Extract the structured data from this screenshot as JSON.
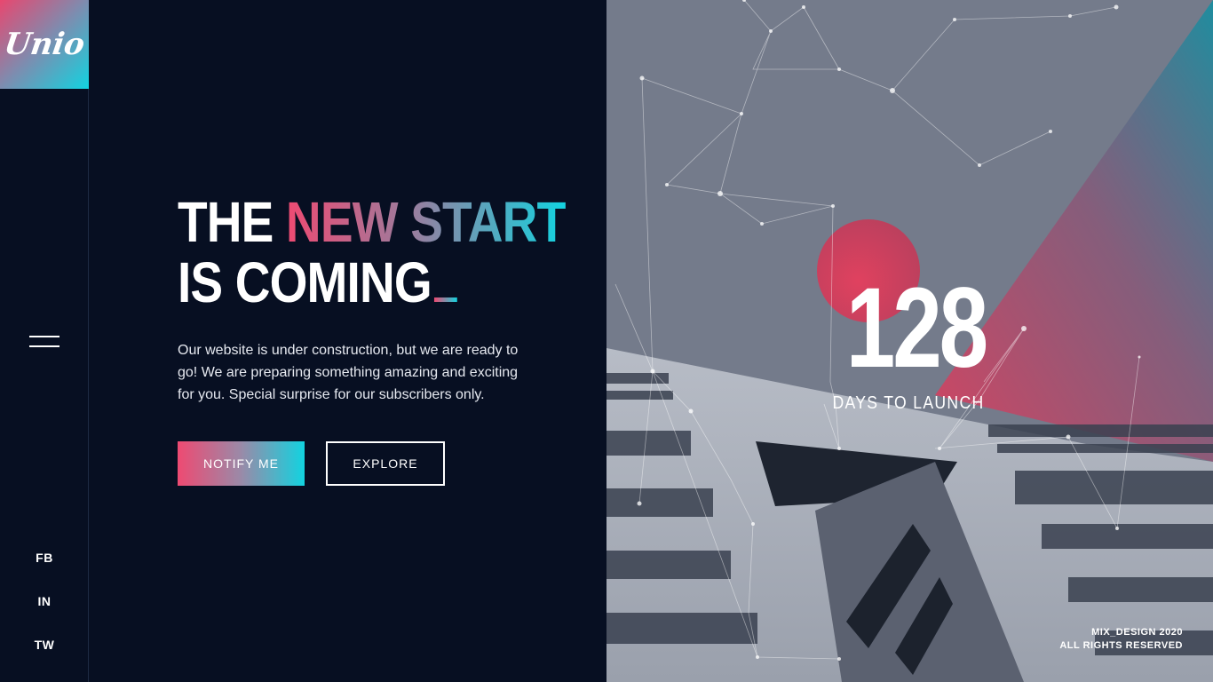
{
  "brand": {
    "logo_text": "Unio"
  },
  "sidebar": {
    "social": [
      {
        "label": "FB"
      },
      {
        "label": "IN"
      },
      {
        "label": "TW"
      }
    ]
  },
  "hero": {
    "headline_word_1": "THE",
    "headline_highlight": "NEW START",
    "headline_line_2": "IS COMING",
    "description": "Our website is under construction, but we are ready to go! We are preparing something amazing and exciting for you. Special surprise for our subscribers only.",
    "notify_label": "NOTIFY ME",
    "explore_label": "EXPLORE"
  },
  "countdown": {
    "value": "128",
    "label": "DAYS TO LAUNCH"
  },
  "footer": {
    "line_1": "MIX_DESIGN 2020",
    "line_2": "ALL RIGHTS RESERVED"
  },
  "colors": {
    "background": "#070f22",
    "accent_pink": "#ee4a72",
    "accent_cyan": "#12d3e0"
  },
  "icons": [
    "hamburger-menu-icon"
  ]
}
